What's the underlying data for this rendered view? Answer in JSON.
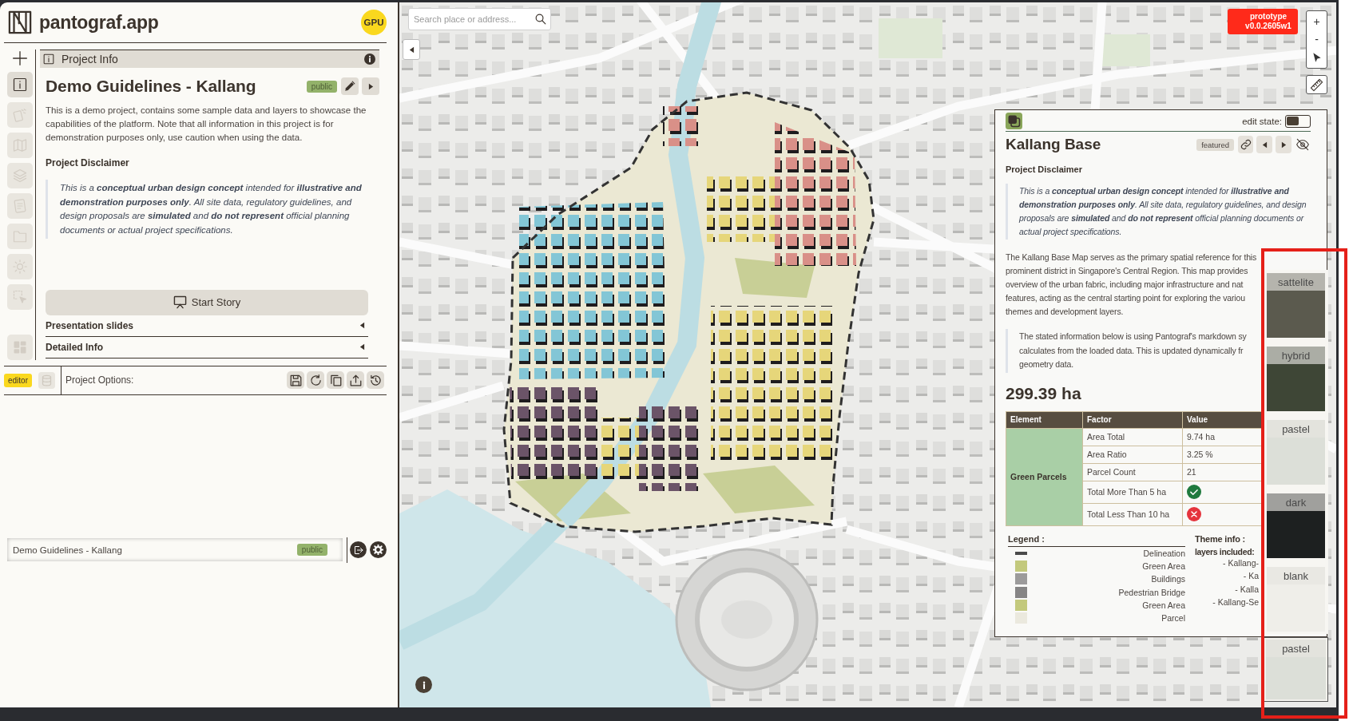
{
  "app": {
    "name": "pantograf.app",
    "gpu_badge": "GPU"
  },
  "sidebar": {
    "items": [
      {
        "selected": true
      },
      {
        "selected": false
      },
      {
        "selected": false
      },
      {
        "selected": false
      },
      {
        "selected": false
      },
      {
        "selected": false
      },
      {
        "selected": false
      },
      {
        "selected": false
      }
    ],
    "footer_item": {
      "selected": false
    }
  },
  "panel": {
    "header": "Project Info",
    "title": "Demo Guidelines - Kallang",
    "badge": "public",
    "description": "This is a demo project, contains some sample data and layers to showcase the capabilities of the platform. Note that all information in this project is for demonstration purposes only, use caution when using the data.",
    "disclaimer_title": "Project Disclaimer",
    "disclaimer": "This is a **conceptual urban design concept** intended for **illustrative and demonstration purposes only**. All site data, regulatory guidelines, and design proposals are **simulated** and **do not represent** official planning documents or actual project specifications.",
    "start_button": "Start Story",
    "sections": [
      {
        "label": "Presentation slides",
        "expanded": false
      },
      {
        "label": "Detailed Info",
        "expanded": false
      }
    ]
  },
  "project_bar": {
    "role_badge": "editor",
    "options_label": "Project Options:",
    "project_name": "Demo Guidelines - Kallang",
    "project_badge": "public"
  },
  "map": {
    "search": {
      "placeholder": "Search place or address..."
    },
    "version_badge": {
      "name": "prototype",
      "version": "v0.0.2605w1"
    },
    "zoom_in": "+",
    "zoom_out": "-"
  },
  "info_card": {
    "edit_state": {
      "label": "edit state:",
      "on": false
    },
    "title": "Kallang Base",
    "badge": "featured",
    "disclaimer_title": "Project Disclaimer",
    "disclaimer": "This is a **conceptual urban design concept** intended for **illustrative and demonstration purposes only**. All site data, regulatory guidelines, and design proposals are **simulated** and **do not represent** official planning documents or actual project specifications.",
    "description_lines": [
      "The Kallang Base Map serves as the primary spatial reference for this",
      "prominent district in Singapore's Central Region. This map provides",
      "overview of the urban fabric, including major infrastructure and nat",
      "features, acting as the central starting point for exploring the variou",
      "themes and development layers."
    ],
    "note_lines": [
      "The stated information below is using Pantograf's markdown sy",
      "calculates from the loaded data. This is updated dynamically fr",
      "geometry data."
    ],
    "area": "299.39 ha",
    "table": {
      "columns": [
        "Element",
        "Factor",
        "Value"
      ],
      "group": "Green Parcels",
      "rows": [
        {
          "kind": "text",
          "factor": "Area Total",
          "value": "9.74 ha"
        },
        {
          "kind": "text",
          "factor": "Area Ratio",
          "value": "3.25 %"
        },
        {
          "kind": "text",
          "factor": "Parcel Count",
          "value": "21"
        },
        {
          "kind": "status",
          "factor": "Total More Than 5 ha",
          "passed": true
        },
        {
          "kind": "status",
          "factor": "Total Less Than 10 ha",
          "passed": false
        }
      ]
    },
    "legend": {
      "title": "Legend :",
      "items": [
        {
          "kind": "line",
          "label": "Delineation",
          "color": "#4a4a4a"
        },
        {
          "kind": "fill",
          "label": "Green Area",
          "color": "#c3c97c"
        },
        {
          "kind": "fill",
          "label": "Buildings",
          "color": "#9c9b9b"
        },
        {
          "kind": "fill",
          "label": "Pedestrian Bridge",
          "color": "#868585"
        },
        {
          "kind": "fill",
          "label": "Green Area",
          "color": "#c3c97c"
        },
        {
          "kind": "fill",
          "label": "Parcel",
          "color": "#ebe9de"
        }
      ]
    },
    "theme_info": {
      "title": "Theme info :",
      "subtitle": "layers included:",
      "layers": [
        "- Kallang-",
        "- Ka",
        "- Kalla",
        "- Kallang-Se"
      ]
    }
  },
  "basemaps": {
    "options": [
      {
        "label": "sattelite",
        "color": "#5b5a4e"
      },
      {
        "label": "hybrid",
        "color": "#3e4636"
      },
      {
        "label": "pastel",
        "color": "#dcdfd8"
      },
      {
        "label": "dark",
        "color": "#1d2020"
      },
      {
        "label": "blank",
        "color": "#efeee9"
      }
    ],
    "current": {
      "label": "pastel",
      "color": "#dcdfd8"
    }
  }
}
